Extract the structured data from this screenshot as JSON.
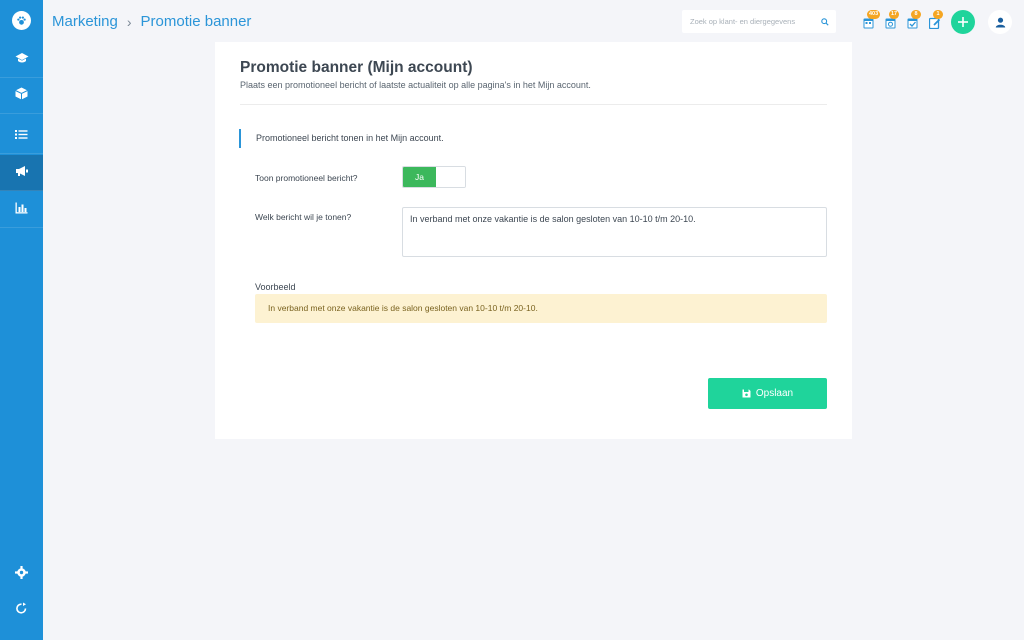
{
  "breadcrumb": {
    "parent": "Marketing",
    "current": "Promotie banner"
  },
  "search": {
    "placeholder": "Zoek op klant- en diergegevens"
  },
  "badges": [
    "403",
    "17",
    "8",
    "1"
  ],
  "page": {
    "title": "Promotie banner (Mijn account)",
    "subtitle": "Plaats een promotioneel bericht of laatste actualiteit op alle pagina's in het Mijn account."
  },
  "section": {
    "heading": "Promotioneel bericht tonen in het Mijn account."
  },
  "form": {
    "show_label": "Toon promotioneel bericht?",
    "toggle_on_label": "Ja",
    "message_label": "Welk bericht wil je tonen?",
    "message_value": "In verband met onze vakantie is de salon gesloten van 10-10 t/m 20-10."
  },
  "preview": {
    "label": "Voorbeeld",
    "text": "In verband met onze vakantie is de salon gesloten van 10-10 t/m 20-10."
  },
  "actions": {
    "save_label": "Opslaan"
  },
  "colors": {
    "sidebar": "#1e90d8",
    "accent": "#2b95d8",
    "success": "#1fd49b",
    "toggle_on": "#3cb85c",
    "badge": "#f5a623",
    "preview_bg": "#fdf2d2"
  },
  "icons": {
    "sidebar": [
      "paw-icon",
      "graduation-cap-icon",
      "box-icon",
      "list-icon",
      "megaphone-icon",
      "bar-chart-icon"
    ],
    "sidebar_bottom": [
      "gear-icon",
      "refresh-icon"
    ],
    "topbar": [
      "search-icon",
      "calendar-icon",
      "appointments-icon",
      "tasks-icon",
      "edit-icon",
      "plus-icon",
      "user-icon"
    ]
  }
}
